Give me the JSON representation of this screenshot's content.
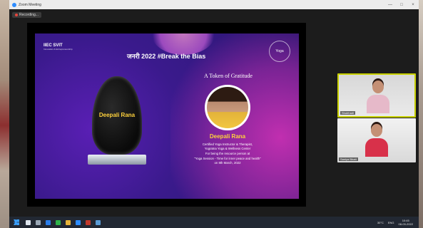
{
  "window": {
    "title": "Zoom Meeting",
    "controls": [
      "—",
      "□",
      "×"
    ]
  },
  "recording": {
    "label": "Recording..."
  },
  "slide": {
    "logo_left": "IIEC SVIT",
    "logo_left_sub": "Innovation & Entrepreneurship",
    "logo_right": "Yoga",
    "headline": "जनरी 2022 #Break the Bias",
    "gratitude": "A Token of Gratitude",
    "trophy_name": "Deepali Rana",
    "name": "Deepali Rana",
    "caption_lines": [
      "Certified Yoga Instructor & Therapist,",
      "Yogratna Yoga & Wellness Center",
      "For being the resource person at",
      "\"Yoga Session - Time for inner peace and health\"",
      "on 8th March, 2022"
    ]
  },
  "participants": [
    {
      "label": "Shubhadi"
    },
    {
      "label": "Saniya Bhatt"
    }
  ],
  "taskbar": {
    "tray_weather": "30°C",
    "tray_lang": "ENG",
    "time": "10:45",
    "date": "08-03-2022"
  },
  "colors": {
    "accent_zoom": "#2d8cff",
    "active_speaker_border": "#c8d000",
    "name_yellow": "#ffd23c",
    "slide_purple": "#3a1a8c",
    "slide_magenta": "#c12fb0"
  }
}
